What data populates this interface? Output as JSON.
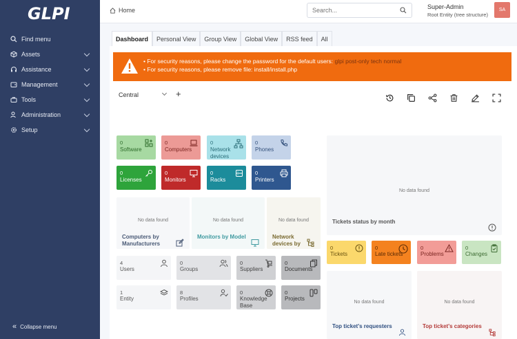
{
  "sidebar": {
    "logo": "GLPI",
    "items": [
      {
        "label": "Find menu",
        "icon": "search-icon",
        "expandable": false
      },
      {
        "label": "Assets",
        "icon": "box-icon",
        "expandable": true
      },
      {
        "label": "Assistance",
        "icon": "headset-icon",
        "expandable": true
      },
      {
        "label": "Management",
        "icon": "wallet-icon",
        "expandable": true
      },
      {
        "label": "Tools",
        "icon": "briefcase-icon",
        "expandable": true
      },
      {
        "label": "Administration",
        "icon": "user-shield-icon",
        "expandable": true
      },
      {
        "label": "Setup",
        "icon": "gear-icon",
        "expandable": true
      }
    ],
    "collapse_label": "Collapse menu"
  },
  "header": {
    "breadcrumb": "Home",
    "search_placeholder": "Search...",
    "user_name": "Super-Admin",
    "user_entity": "Root Entity (tree structure)",
    "avatar_initials": "SA"
  },
  "tabs": [
    "Dashboard",
    "Personal View",
    "Group View",
    "Global View",
    "RSS feed",
    "All"
  ],
  "alert": {
    "line1_prefix": "For security reasons, please change the password for the default users: ",
    "line1_users": "glpi post-only tech normal",
    "line2": "For security reasons, please remove file: install/install.php"
  },
  "dashboard": {
    "selected": "Central",
    "add": "+"
  },
  "cards_row1": [
    {
      "count": "0",
      "label": "Software",
      "bg": "#a7d9a2",
      "fg": "#2e6b2a",
      "icon": "apps-icon"
    },
    {
      "count": "0",
      "label": "Computers",
      "bg": "#ec9a96",
      "fg": "#7a2521",
      "icon": "laptop-icon"
    },
    {
      "count": "0",
      "label": "Network devices",
      "bg": "#a9e1e9",
      "fg": "#2a6d78",
      "icon": "network-icon"
    },
    {
      "count": "0",
      "label": "Phones",
      "bg": "#c4d3e9",
      "fg": "#33507b",
      "icon": "phone-icon"
    }
  ],
  "cards_row2": [
    {
      "count": "0",
      "label": "Licenses",
      "bg": "#2ea43b",
      "fg": "#ffffff",
      "icon": "key-icon"
    },
    {
      "count": "0",
      "label": "Monitors",
      "bg": "#bf2a2a",
      "fg": "#ffffff",
      "icon": "monitor-icon"
    },
    {
      "count": "0",
      "label": "Racks",
      "bg": "#1c8c9b",
      "fg": "#ffffff",
      "icon": "rack-icon"
    },
    {
      "count": "0",
      "label": "Printers",
      "bg": "#2f578f",
      "fg": "#ffffff",
      "icon": "printer-icon"
    }
  ],
  "charts": [
    {
      "nodata": "No data found",
      "title": "Computers by Manufacturers",
      "color": "#4a5a76",
      "icon": "edit-icon"
    },
    {
      "nodata": "No data found",
      "title": "Monitors by Model",
      "color": "#3f9aa0",
      "icon": "monitor-icon"
    },
    {
      "nodata": "No data found",
      "title": "Network devices by",
      "color": "#7a6a30",
      "icon": "network-icon"
    }
  ],
  "tickets_status": {
    "nodata": "No data found",
    "title": "Tickets status by month",
    "icon": "alert-circle-icon"
  },
  "ticket_cards": [
    {
      "count": "0",
      "label": "Tickets",
      "bg": "#fbd86c",
      "fg": "#6a5310",
      "icon": "alert-icon"
    },
    {
      "count": "0",
      "label": "Late tickets",
      "bg": "#f4821f",
      "fg": "#5a2a05",
      "icon": "clock-icon"
    },
    {
      "count": "0",
      "label": "Problems",
      "bg": "#f29c97",
      "fg": "#7a2521",
      "icon": "warning-icon"
    },
    {
      "count": "0",
      "label": "Changes",
      "bg": "#c9e5c2",
      "fg": "#3d6b33",
      "icon": "clipboard-icon"
    }
  ],
  "admin_cards_row1": [
    {
      "count": "4",
      "label": "Users",
      "bg": "#f4f5f7",
      "fg": "#555555",
      "icon": "user-icon"
    },
    {
      "count": "0",
      "label": "Groups",
      "bg": "#e2e3e6",
      "fg": "#555555",
      "icon": "users-icon"
    },
    {
      "count": "0",
      "label": "Suppliers",
      "bg": "#cfd0d3",
      "fg": "#444444",
      "icon": "dolly-icon"
    },
    {
      "count": "0",
      "label": "Documents",
      "bg": "#b8b9bc",
      "fg": "#333333",
      "icon": "files-icon"
    }
  ],
  "admin_cards_row2": [
    {
      "count": "1",
      "label": "Entity",
      "bg": "#f4f5f7",
      "fg": "#555555",
      "icon": "layers-icon"
    },
    {
      "count": "8",
      "label": "Profiles",
      "bg": "#e2e3e6",
      "fg": "#555555",
      "icon": "user-check-icon"
    },
    {
      "count": "0",
      "label": "Knowledge Base",
      "bg": "#cfd0d3",
      "fg": "#444444",
      "icon": "lifebuoy-icon"
    },
    {
      "count": "0",
      "label": "Projects",
      "bg": "#b8b9bc",
      "fg": "#333333",
      "icon": "project-icon"
    }
  ],
  "bottom_widgets": [
    {
      "nodata": "No data found",
      "title": "Top ticket's requesters",
      "color": "#2f4f80",
      "icon": "user-icon"
    },
    {
      "nodata": "No data found",
      "title": "Top ticket's categories",
      "color": "#b33a38",
      "icon": "tree-icon"
    }
  ]
}
